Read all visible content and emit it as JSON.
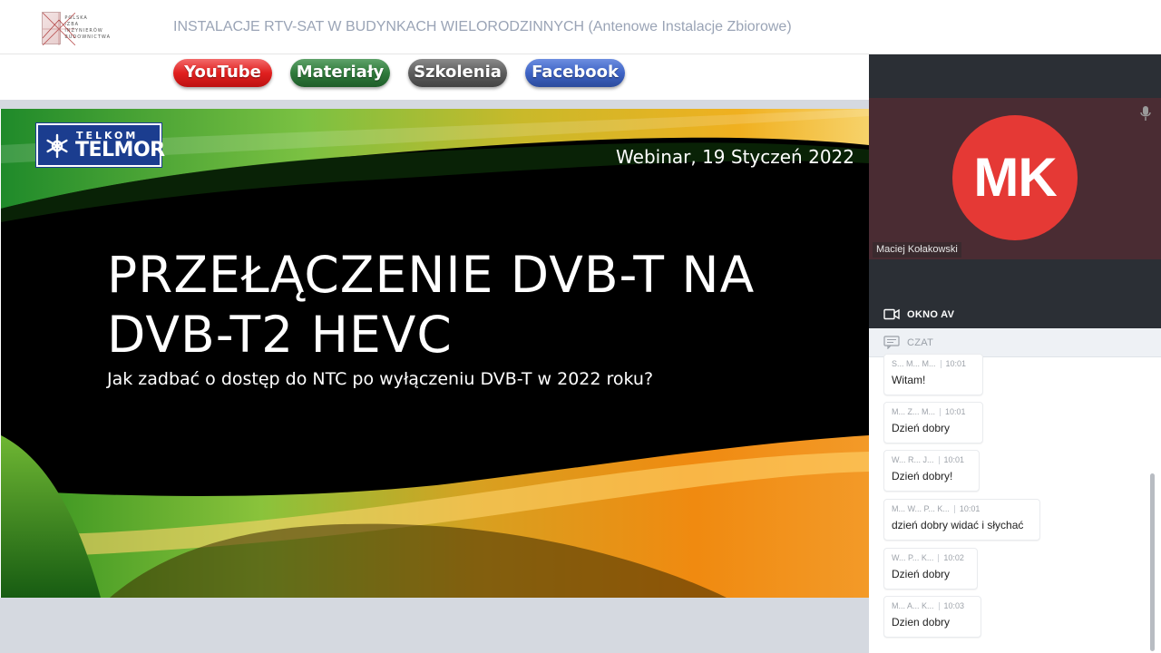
{
  "header": {
    "logo": {
      "lines": [
        "POLSKA",
        "IZBA",
        "INŻYNIERÓW",
        "BUDOWNICTWA"
      ]
    },
    "title": "INSTALACJE RTV-SAT W BUDYNKACH WIELORODZINNYCH (Antenowe Instalacje Zbiorowe)"
  },
  "links": {
    "youtube": "YouTube",
    "materialy": "Materiały",
    "szkolenia": "Szkolenia",
    "facebook": "Facebook"
  },
  "slide": {
    "brand_top": "TELKOM",
    "brand_main": "TELMOR",
    "date": "Webinar, 19 Styczeń 2022",
    "title_line1": "PRZEŁĄCZENIE DVB-T NA",
    "title_line2": "DVB-T2 HEVC",
    "subtitle": "Jak zadbać o dostęp do NTC po wyłączeniu DVB-T w 2022 roku?"
  },
  "video": {
    "initials": "MK",
    "participant_name": "Maciej Kołakowski",
    "avatar_color": "#e53935",
    "av_label": "OKNO AV"
  },
  "chat": {
    "label": "CZAT",
    "messages": [
      {
        "author": "S... M... M...",
        "time": "10:01",
        "text": "Witam!"
      },
      {
        "author": "M... Z... M...",
        "time": "10:01",
        "text": "Dzień dobry"
      },
      {
        "author": "W... R... J...",
        "time": "10:01",
        "text": "Dzień dobry!"
      },
      {
        "author": "M... W... P... K...",
        "time": "10:01",
        "text": "dzień dobry widać i słychać"
      },
      {
        "author": "W... P... K...",
        "time": "10:02",
        "text": "Dzień dobry"
      },
      {
        "author": "M... A... K...",
        "time": "10:03",
        "text": "Dzien dobry"
      }
    ]
  }
}
